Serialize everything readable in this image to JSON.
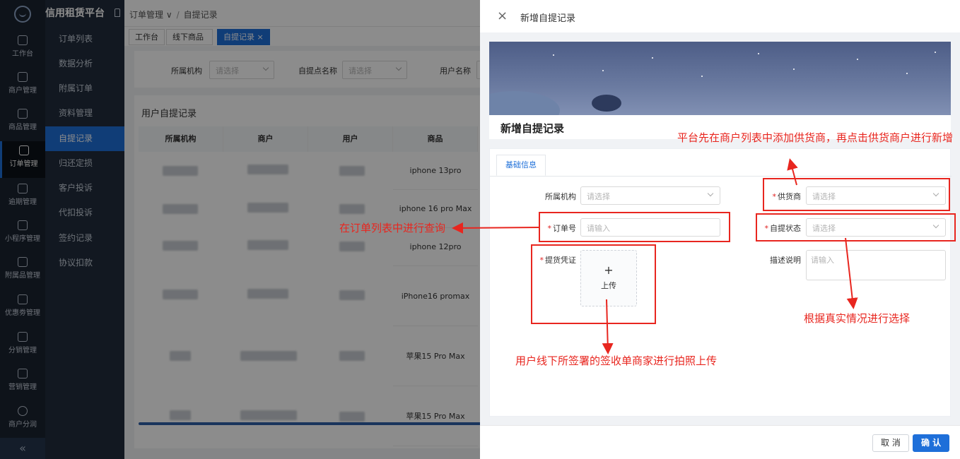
{
  "app": {
    "brand": "信用租赁平台"
  },
  "rail": {
    "items": [
      "工作台",
      "商户管理",
      "商品管理",
      "订单管理",
      "逾期管理",
      "小程序管理",
      "附属品管理",
      "优惠劵管理",
      "分销管理",
      "营销管理",
      "商户分润"
    ],
    "active_index": 3,
    "collapse": "«"
  },
  "submenu": {
    "items": [
      "订单列表",
      "数据分析",
      "附属订单",
      "资料管理",
      "自提记录",
      "归还定损",
      "客户投诉",
      "代扣投诉",
      "签约记录",
      "协议扣款"
    ],
    "active_index": 4
  },
  "breadcrumb": {
    "parent": "订单管理",
    "current": "自提记录"
  },
  "tabs": [
    "工作台",
    "线下商品",
    "自提记录"
  ],
  "tab_close": "×",
  "filter": {
    "org_label": "所属机构",
    "org_placeholder": "请选择",
    "point_label": "自提点名称",
    "point_placeholder": "请选择",
    "user_label": "用户名称"
  },
  "table": {
    "title": "用户自提记录",
    "columns": [
      "所属机构",
      "商户",
      "用户",
      "商品"
    ],
    "products": [
      "iphone 13pro",
      "iphone 16 pro Max",
      "iphone 12pro",
      "iPhone16 promax",
      "苹果15 Pro Max",
      "苹果15 Pro Max"
    ]
  },
  "drawer": {
    "title": "新增自提记录",
    "banner_title": "新增自提记录",
    "section_tab": "基础信息",
    "fields": {
      "org": {
        "label": "所属机构",
        "placeholder": "请选择"
      },
      "supplier": {
        "label": "供货商",
        "placeholder": "请选择"
      },
      "order_no": {
        "label": "订单号",
        "placeholder": "请输入"
      },
      "status": {
        "label": "自提状态",
        "placeholder": "请选择"
      },
      "voucher": {
        "label": "提货凭证",
        "upload": "上传",
        "plus": "+"
      },
      "desc": {
        "label": "描述说明",
        "placeholder": "请输入"
      }
    },
    "cancel": "取 消",
    "confirm": "确 认",
    "close_icon": "×"
  },
  "annotations": {
    "supplier_note": "平台先在商户列表中添加供货商，再点击供货商户进行新增",
    "order_note": "在订单列表中进行查询",
    "status_note": "根据真实情况进行选择",
    "upload_note": "用户线下所签署的签收单商家进行拍照上传"
  },
  "colors": {
    "accent": "#1e6fd9",
    "annotation": "#e8261f",
    "rail_bg": "#1b2431",
    "submenu_bg": "#222d3c"
  }
}
